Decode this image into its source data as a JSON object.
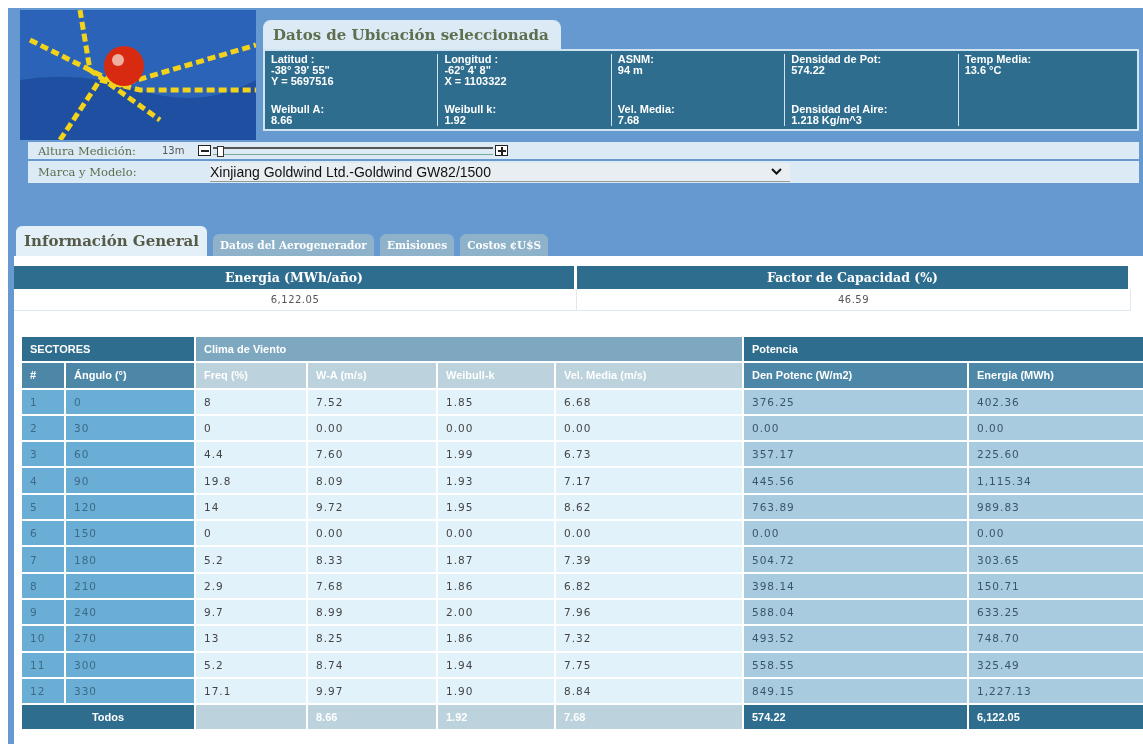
{
  "location": {
    "title": "Datos de Ubicación seleccionada",
    "columns": [
      [
        {
          "label": "Latitud :",
          "values": [
            "-38° 39' 55\"",
            "Y = 5697516"
          ]
        },
        {
          "label": "Weibull A:",
          "values": [
            "8.66"
          ]
        }
      ],
      [
        {
          "label": "Longitud :",
          "values": [
            "-62° 4' 8\"",
            "X = 1103322"
          ]
        },
        {
          "label": "Weibull k:",
          "values": [
            "1.92"
          ]
        }
      ],
      [
        {
          "label": "ASNM:",
          "values": [
            "94 m"
          ]
        },
        {
          "label": "Vel. Media:",
          "values": [
            "7.68"
          ]
        }
      ],
      [
        {
          "label": "Densidad de Pot:",
          "values": [
            "574.22"
          ]
        },
        {
          "label": "Densidad del Aire:",
          "values": [
            "1.218 Kg/m^3"
          ]
        }
      ],
      [
        {
          "label": "Temp Media:",
          "values": [
            "13.6 °C"
          ]
        }
      ]
    ]
  },
  "height": {
    "label": "Altura Medición:",
    "value": "13m",
    "level": 0.02
  },
  "model": {
    "label": "Marca y Modelo:",
    "value": "Xinjiang Goldwind Ltd.-Goldwind GW82/1500"
  },
  "tabs": [
    {
      "label": "Información General",
      "selected": true
    },
    {
      "label": "Datos del Aerogenerador",
      "selected": false
    },
    {
      "label": "Emisiones",
      "selected": false
    },
    {
      "label": "Costos ¢U$S",
      "selected": false
    }
  ],
  "summary": {
    "columns": [
      "Energia (MWh/año)",
      "Factor de Capacidad (%)"
    ],
    "values": [
      "6,122.05",
      "46.59"
    ]
  },
  "table": {
    "groups": [
      "SECTORES",
      "Clima de Viento",
      "Potencia"
    ],
    "columns": [
      "#",
      "Ángulo (°)",
      "Freq (%)",
      "W-A (m/s)",
      "Weibull-k",
      "Vel. Media (m/s)",
      "Den Potenc (W/m2)",
      "Energia (MWh)"
    ],
    "rows": [
      [
        "1",
        "0",
        "8",
        "7.52",
        "1.85",
        "6.68",
        "376.25",
        "402.36"
      ],
      [
        "2",
        "30",
        "0",
        "0.00",
        "0.00",
        "0.00",
        "0.00",
        "0.00"
      ],
      [
        "3",
        "60",
        "4.4",
        "7.60",
        "1.99",
        "6.73",
        "357.17",
        "225.60"
      ],
      [
        "4",
        "90",
        "19.8",
        "8.09",
        "1.93",
        "7.17",
        "445.56",
        "1,115.34"
      ],
      [
        "5",
        "120",
        "14",
        "9.72",
        "1.95",
        "8.62",
        "763.89",
        "989.83"
      ],
      [
        "6",
        "150",
        "0",
        "0.00",
        "0.00",
        "0.00",
        "0.00",
        "0.00"
      ],
      [
        "7",
        "180",
        "5.2",
        "8.33",
        "1.87",
        "7.39",
        "504.72",
        "303.65"
      ],
      [
        "8",
        "210",
        "2.9",
        "7.68",
        "1.86",
        "6.82",
        "398.14",
        "150.71"
      ],
      [
        "9",
        "240",
        "9.7",
        "8.99",
        "2.00",
        "7.96",
        "588.04",
        "633.25"
      ],
      [
        "10",
        "270",
        "13",
        "8.25",
        "1.86",
        "7.32",
        "493.52",
        "748.70"
      ],
      [
        "11",
        "300",
        "5.2",
        "8.74",
        "1.94",
        "7.75",
        "558.55",
        "325.49"
      ],
      [
        "12",
        "330",
        "17.1",
        "9.97",
        "1.90",
        "8.84",
        "849.15",
        "1,227.13"
      ]
    ],
    "total": {
      "label": "Todos",
      "values": [
        "8.66",
        "1.92",
        "7.68",
        "574.22",
        "6,122.05"
      ]
    }
  }
}
